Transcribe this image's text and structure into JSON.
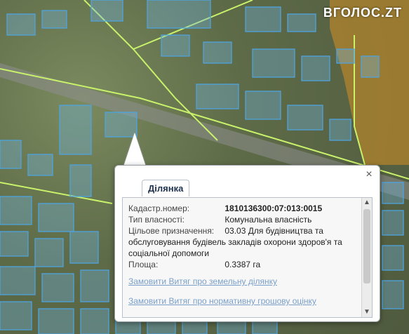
{
  "watermark": {
    "text": "ВГОЛОС.ZT"
  },
  "popup": {
    "tab_title": "Ділянка",
    "fields": {
      "cad_label": "Кадастр.номер:",
      "cad_value": "1810136300:07:013:0015",
      "owner_label": "Тип власності:",
      "owner_value": "Комунальна власність",
      "purpose_label": "Цільове призначення:",
      "purpose_value": "03.03 Для будівництва та",
      "purpose_line2": "обслуговування будівель закладів охорони здоров'я та",
      "purpose_line3": "соціальної допомоги",
      "area_label": "Площа:",
      "area_value": "0.3387 га"
    },
    "links": {
      "extract_land": "Замовити Витяг про земельну ділянку",
      "extract_valuation": "Замовити Витяг про нормативну грошову оцінку"
    },
    "close_symbol": "×",
    "scroll_up_symbol": "▲",
    "scroll_down_symbol": "▼"
  },
  "colors": {
    "parcel_fill": "#6fb6e6",
    "parcel_stroke": "#4ea3e0",
    "boundary": "#c9f26b",
    "brown_zone": "#b8862b"
  },
  "icons": {
    "close": "close-icon"
  }
}
